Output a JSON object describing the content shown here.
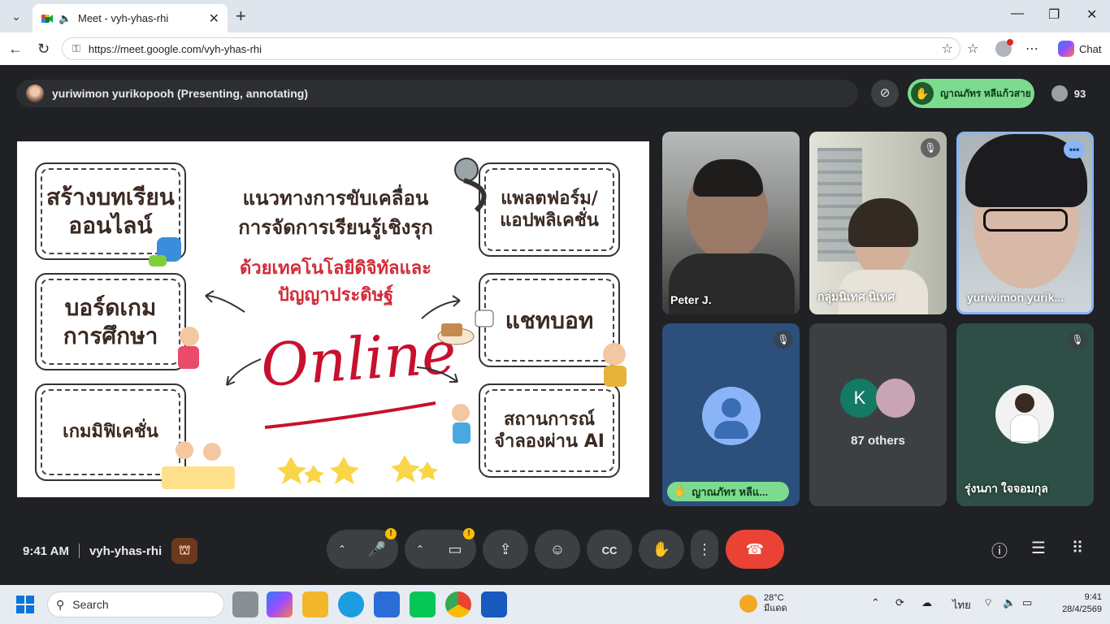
{
  "browser": {
    "tab_title": "Meet - vyh-yhas-rhi",
    "url": "https://meet.google.com/vyh-yhas-rhi",
    "chat_label": "Chat"
  },
  "meet": {
    "presenter_label": "yuriwimon yurikopooh (Presenting, annotating)",
    "hand_raised_name": "ญาณภัทร หลีแก้วสาย",
    "participant_count": "93",
    "time": "9:41 AM",
    "meeting_code": "vyh-yhas-rhi"
  },
  "slide": {
    "box1": "สร้างบทเรียน\nออนไลน์",
    "box2": "บอร์ดเกม\nการศึกษา",
    "box3": "เกมมิฟิเคชั่น",
    "box4": "แพลตฟอร์ม/\nแอปพลิเคชั่น",
    "box5": "แชทบอท",
    "box6": "สถานการณ์\nจำลองผ่าน AI",
    "title": "แนวทางการขับเคลื่อน\nการจัดการเรียนรู้เชิงรุก",
    "subtitle": "ด้วยเทคโนโลยีดิจิทัลและ\nปัญญาประดิษฐ์",
    "online": "Online"
  },
  "tiles": {
    "t1": "Peter J.",
    "t2": "กลุ่มนิเทศ นิเทศ",
    "t3": "yuriwimon yurik...",
    "t4": "ญาณภัทร หลีแ...",
    "t5_initial": "K",
    "t5": "87 others",
    "t6": "รุ่งนภา ใจจอมกุล"
  },
  "taskbar": {
    "search_placeholder": "Search",
    "temp": "28°C",
    "weather": "มีแดด",
    "lang": "ไทย",
    "clock_time": "9:41",
    "clock_date": "28/4/2569"
  },
  "colors": {
    "meet_bg": "#202124",
    "hand_green": "#7ddb8f",
    "end_call_red": "#ea4335",
    "slide_red": "#d22c38"
  }
}
